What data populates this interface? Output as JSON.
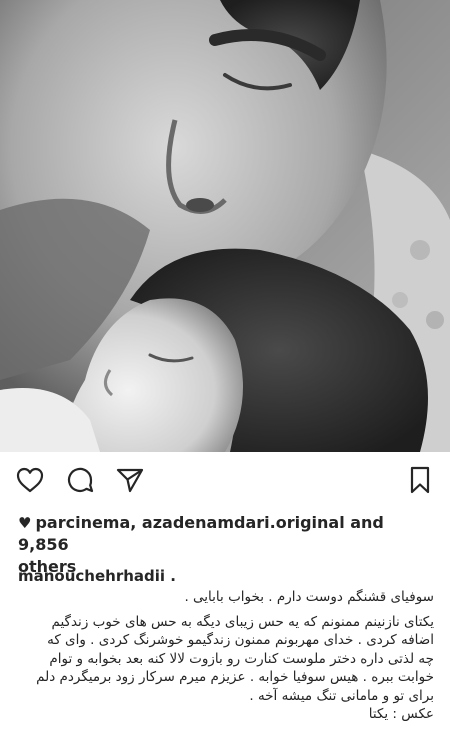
{
  "post": {
    "photo_description_icon": "photo",
    "actions": {
      "like_icon": "heart-outline-icon",
      "comment_icon": "comment-bubble-icon",
      "share_icon": "paper-plane-icon",
      "save_icon": "bookmark-icon"
    },
    "likes": {
      "heart_glyph": "♥",
      "text_part1": "parcinema, azadenamdari.original and 9,856",
      "text_part2": "others"
    },
    "author": "manouchehrhadii .",
    "caption_lines": [
      "سوفیای قشنگم دوست دارم . بخواب بابایی .",
      "یکتای نازنینم ممنونم که یه حس زیبای دیگه به حس های خوب زندگیم",
      "اضافه کردی . خدای مهربونم ممنون زندگیمو خوشرنگ کردی . وای که",
      "چه لذتی داره دختر ملوست کنارت رو بازوت لالا کنه بعد بخوابه و توام",
      "خوابت ببره . هیس سوفیا خوابه . عزیزم میرم سرکار زود برمیگردم دلم",
      "برای تو و مامانی تنگ میشه آخه .",
      "عکس : یکتا"
    ]
  }
}
